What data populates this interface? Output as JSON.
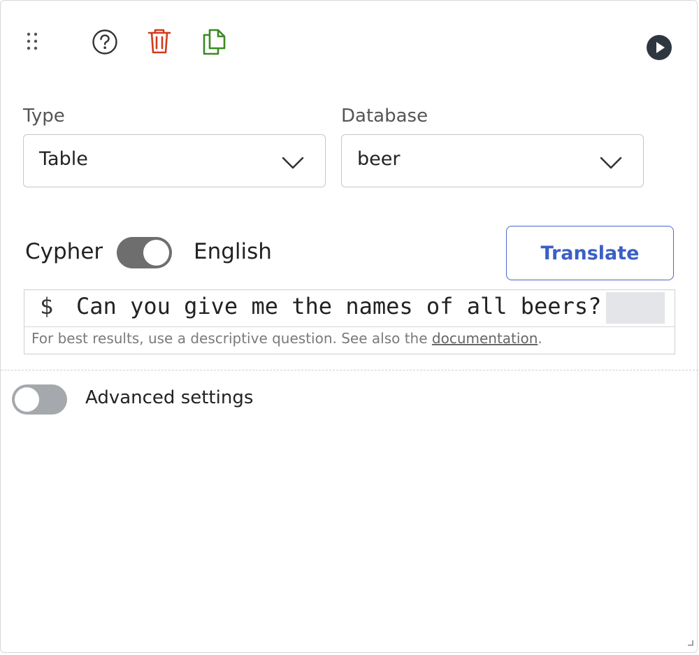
{
  "toolbar": {
    "drag_handle": "drag-handle-icon",
    "help": "help-icon",
    "delete": "trash-icon",
    "copy": "copy-icon",
    "run": "play-icon",
    "colors": {
      "delete": "#d23a1e",
      "copy": "#3a8a1f",
      "icon": "#333333"
    }
  },
  "form": {
    "type_label": "Type",
    "type_value": "Table",
    "database_label": "Database",
    "database_value": "beer"
  },
  "mode": {
    "left_label": "Cypher",
    "right_label": "English",
    "toggle_on": true,
    "translate_label": "Translate"
  },
  "editor": {
    "prompt_symbol": "$",
    "query_text": "Can you give me the names of all beers?",
    "hint_text": "For best results, use a descriptive question. See also the ",
    "hint_link": "documentation",
    "hint_end": "."
  },
  "advanced": {
    "label": "Advanced settings",
    "toggle_on": false
  },
  "accent_color": "#3c5fc6"
}
